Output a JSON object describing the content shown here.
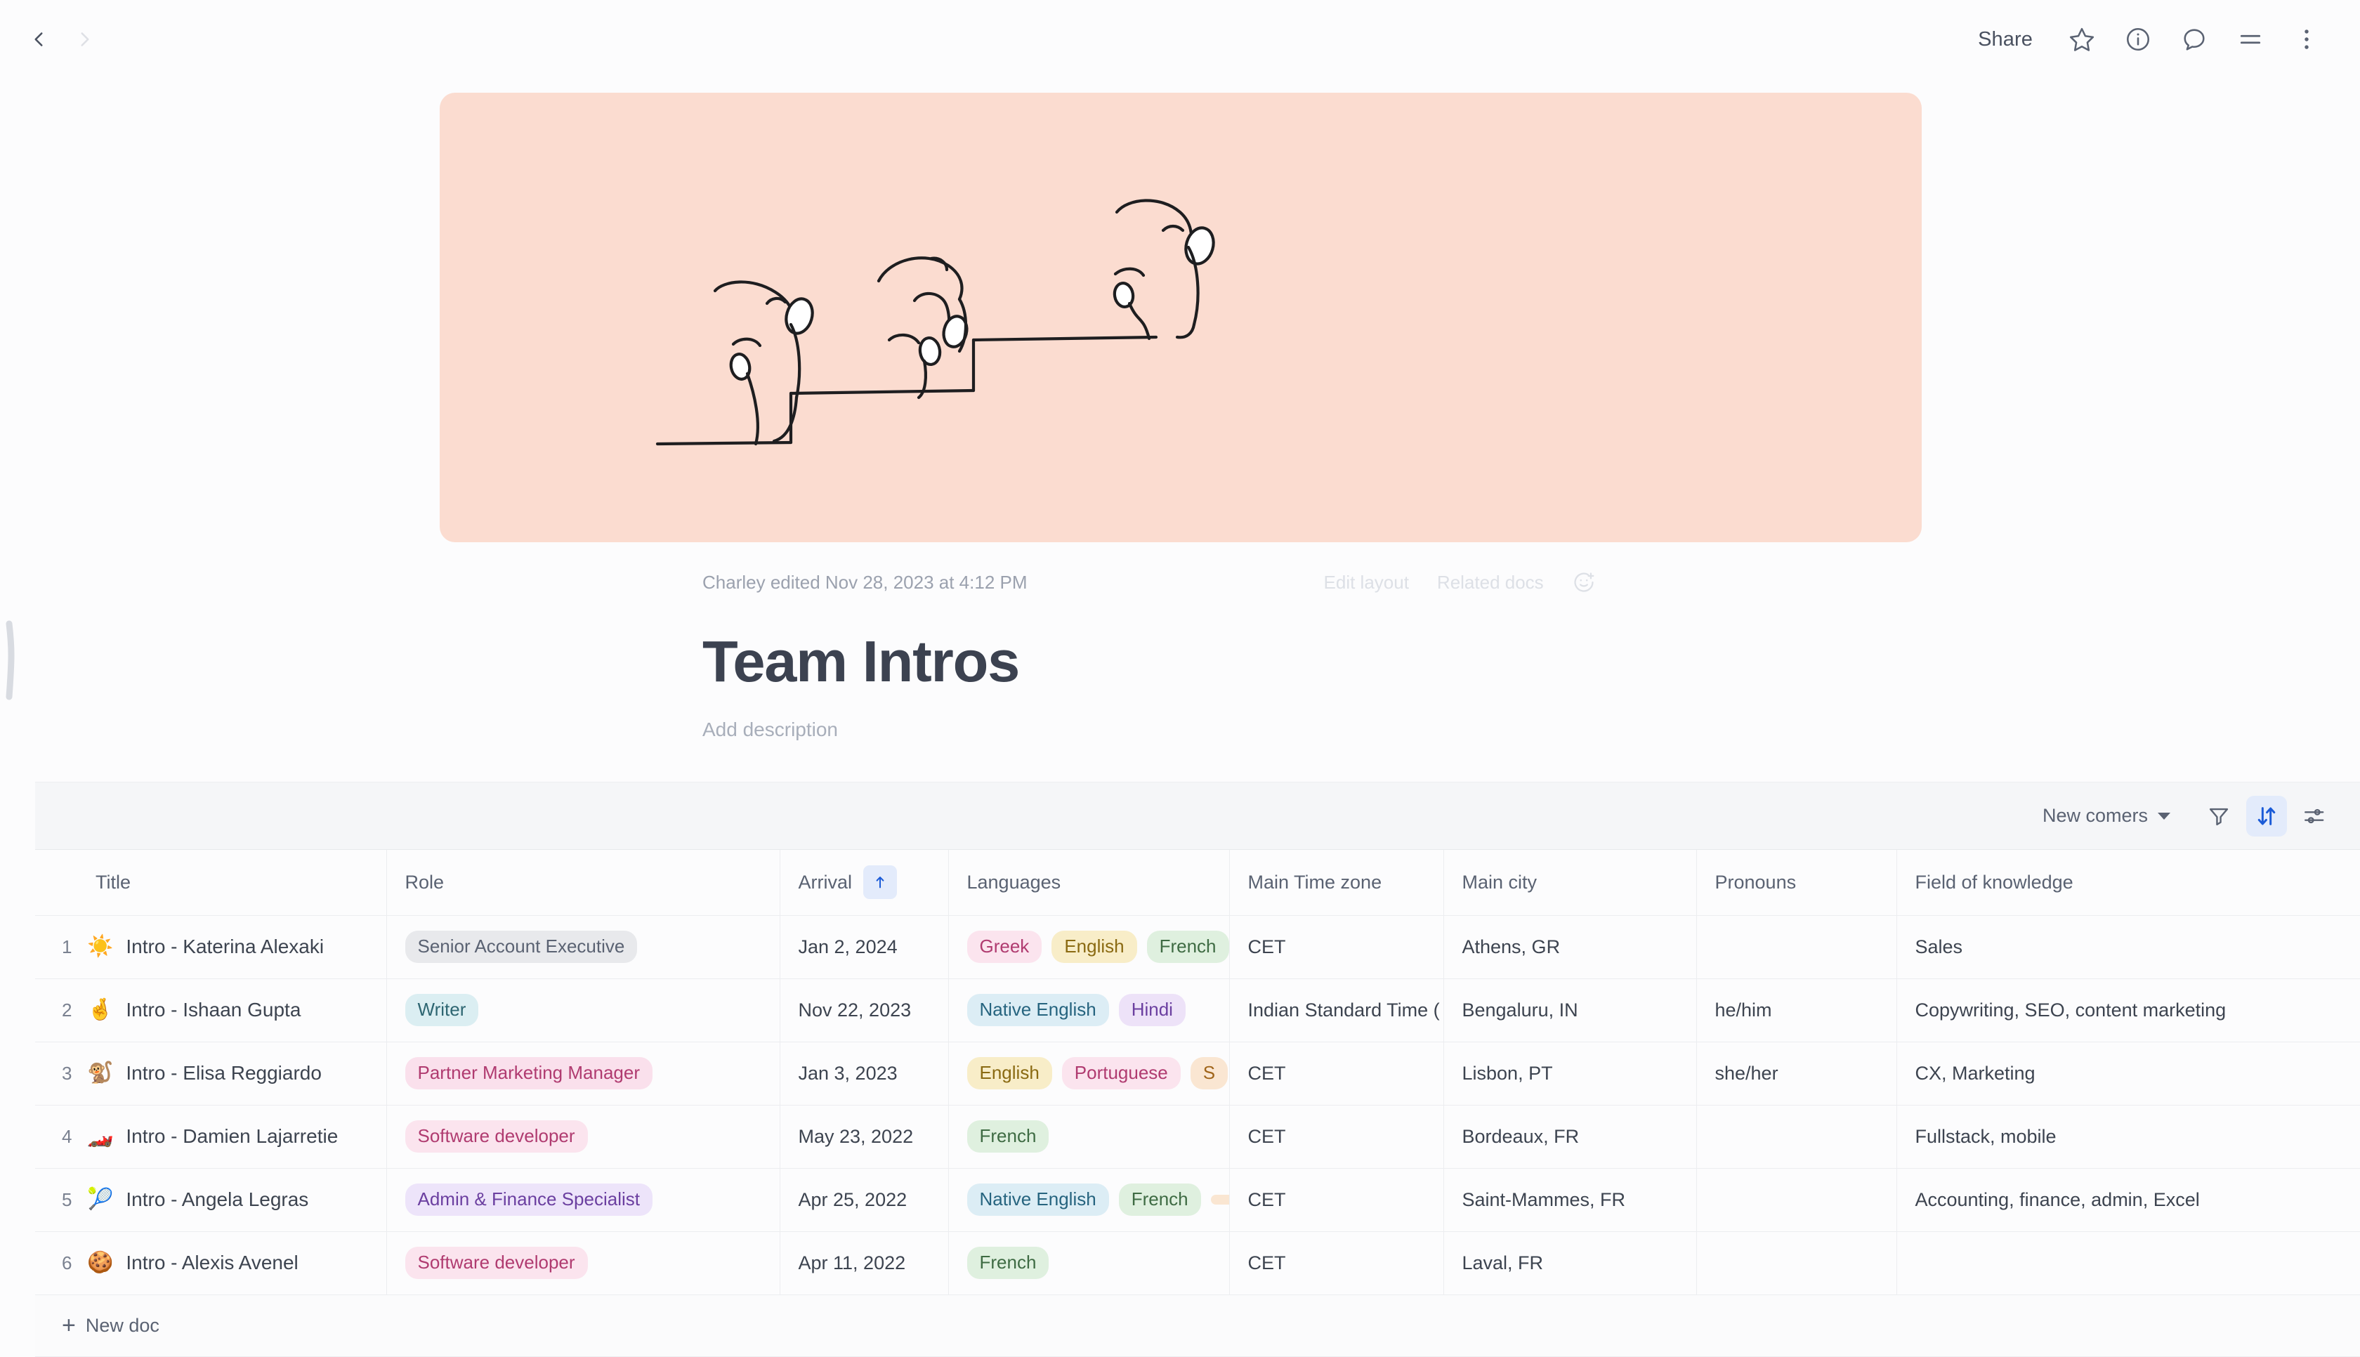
{
  "topbar": {
    "back_icon": "chevron-left-icon",
    "forward_icon": "chevron-right-icon",
    "share_label": "Share",
    "icons": [
      "star-icon",
      "info-circle-icon",
      "comment-bubble-icon",
      "list-lines-icon",
      "more-vertical-icon"
    ]
  },
  "hero": {
    "background_color": "#FBDCD0",
    "illustration": "hand-drawn hands climbing steps"
  },
  "doc": {
    "edited_text": "Charley edited Nov 28, 2023 at 4:12 PM",
    "edit_layout_label": "Edit layout",
    "related_docs_label": "Related docs",
    "reaction_icon": "add-reaction-icon",
    "title": "Team Intros",
    "description_placeholder": "Add description"
  },
  "table_toolbar": {
    "view_name": "New comers",
    "filter_icon": "filter-funnel-icon",
    "sort_icon": "sort-arrows-icon",
    "settings_icon": "sliders-icon",
    "sort_active_color": "#1B5BD7",
    "sort_active_bg": "#E3EBFB"
  },
  "table": {
    "columns": [
      {
        "label": "Title"
      },
      {
        "label": "Role"
      },
      {
        "label": "Arrival",
        "sorted": true,
        "sort_direction": "asc"
      },
      {
        "label": "Languages"
      },
      {
        "label": "Main Time zone"
      },
      {
        "label": "Main city"
      },
      {
        "label": "Pronouns"
      },
      {
        "label": "Field of knowledge"
      }
    ],
    "rows": [
      {
        "num": "1",
        "emoji": "☀️",
        "title": "Intro - Katerina Alexaki",
        "role": {
          "label": "Senior Account Executive",
          "bg": "#E8E9EC",
          "fg": "#5A6272"
        },
        "arrival": "Jan 2, 2024",
        "languages": [
          {
            "label": "Greek",
            "bg": "#FBE4EE",
            "fg": "#B03B70"
          },
          {
            "label": "English",
            "bg": "#F8EDC8",
            "fg": "#8A6A12"
          },
          {
            "label": "French",
            "bg": "#DFF0DF",
            "fg": "#3E6B43"
          }
        ],
        "timezone": "CET",
        "city": "Athens, GR",
        "pronouns": "",
        "field": "Sales"
      },
      {
        "num": "2",
        "emoji": "🤞",
        "title": "Intro - Ishaan Gupta",
        "role": {
          "label": "Writer",
          "bg": "#DBEEF2",
          "fg": "#2E6672"
        },
        "arrival": "Nov 22, 2023",
        "languages": [
          {
            "label": "Native English",
            "bg": "#DCEDF5",
            "fg": "#26647F"
          },
          {
            "label": "Hindi",
            "bg": "#EDE2F8",
            "fg": "#6B3FA0"
          }
        ],
        "timezone": "Indian Standard Time (",
        "city": "Bengaluru, IN",
        "pronouns": "he/him",
        "field": "Copywriting, SEO, content marketing"
      },
      {
        "num": "3",
        "emoji": "🐒",
        "title": "Intro - Elisa Reggiardo",
        "role": {
          "label": "Partner Marketing Manager",
          "bg": "#FAE0EC",
          "fg": "#B03B70"
        },
        "arrival": "Jan 3, 2023",
        "languages": [
          {
            "label": "English",
            "bg": "#F8EDC8",
            "fg": "#8A6A12"
          },
          {
            "label": "Portuguese",
            "bg": "#FBE4EE",
            "fg": "#B03B70"
          },
          {
            "label": "S",
            "bg": "#FAE6D2",
            "fg": "#A0651A"
          }
        ],
        "timezone": "CET",
        "city": "Lisbon, PT",
        "pronouns": "she/her",
        "field": "CX, Marketing"
      },
      {
        "num": "4",
        "emoji": "🏎️",
        "title": "Intro - Damien Lajarretie",
        "role": {
          "label": "Software developer",
          "bg": "#FBE4EE",
          "fg": "#B03B70"
        },
        "arrival": "May 23, 2022",
        "languages": [
          {
            "label": "French",
            "bg": "#DFF0DF",
            "fg": "#3E6B43"
          }
        ],
        "timezone": "CET",
        "city": "Bordeaux, FR",
        "pronouns": "",
        "field": "Fullstack, mobile"
      },
      {
        "num": "5",
        "emoji": "🎾",
        "title": "Intro - Angela Legras",
        "role": {
          "label": "Admin & Finance Specialist",
          "bg": "#EDE4FA",
          "fg": "#6B3FA0"
        },
        "arrival": "Apr 25, 2022",
        "languages": [
          {
            "label": "Native English",
            "bg": "#DCEDF5",
            "fg": "#26647F"
          },
          {
            "label": "French",
            "bg": "#DFF0DF",
            "fg": "#3E6B43"
          },
          {
            "label": "",
            "bg": "#FAE6D2",
            "fg": "#A0651A"
          }
        ],
        "timezone": "CET",
        "city": "Saint-Mammes, FR",
        "pronouns": "",
        "field": "Accounting, finance, admin, Excel"
      },
      {
        "num": "6",
        "emoji": "🍪",
        "title": "Intro - Alexis Avenel",
        "role": {
          "label": "Software developer",
          "bg": "#FBE4EE",
          "fg": "#B03B70"
        },
        "arrival": "Apr 11, 2022",
        "languages": [
          {
            "label": "French",
            "bg": "#DFF0DF",
            "fg": "#3E6B43"
          }
        ],
        "timezone": "CET",
        "city": "Laval, FR",
        "pronouns": "",
        "field": ""
      }
    ],
    "footer_label": "New doc"
  }
}
